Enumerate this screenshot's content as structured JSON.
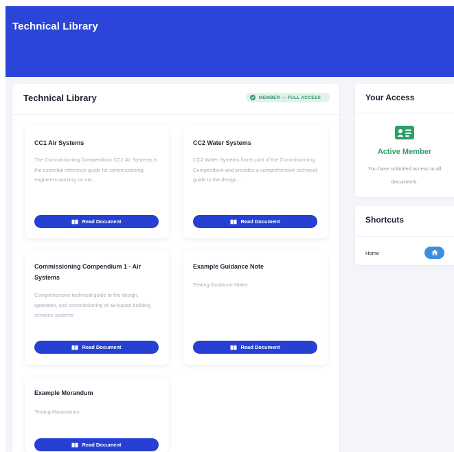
{
  "header": {
    "title": "Technical Library"
  },
  "main": {
    "title": "Technical Library",
    "badge": "MEMBER — FULL ACCESS",
    "button_label": "Read Document",
    "documents": [
      {
        "title": "CC1 Air Systems",
        "description": "The Commissioning Compendium CC1 Air Systems is the essential reference guide for commissioning engineers working on me..."
      },
      {
        "title": "CC2 Water Systems",
        "description": "CC2 Water Systems forms part of the Commissioning Compendium and provides a comprehensive technical guide to the design..."
      },
      {
        "title": "Commissioning Compendium 1 - Air Systems",
        "description": "Comprehensive technical guide to the design, operation, and commissioning of air-based building services systems"
      },
      {
        "title": "Example Guidance Note",
        "description": "Testing Guidance Notes"
      },
      {
        "title": "Example Morandum",
        "description": "Testing Morandums"
      }
    ]
  },
  "sidebar": {
    "access": {
      "title": "Your Access",
      "icon": "member-card-icon",
      "status": "Active Member",
      "note": "You have unlimited access to all documents."
    },
    "shortcuts": {
      "title": "Shortcuts",
      "items": [
        {
          "label": "Home",
          "icon": "home-icon"
        }
      ]
    }
  },
  "colors": {
    "header": "#2a45d8",
    "button": "#2540d3",
    "success": "#2f9e6a",
    "badge_bg": "#dff3ea",
    "home_button": "#3d8ee0"
  }
}
